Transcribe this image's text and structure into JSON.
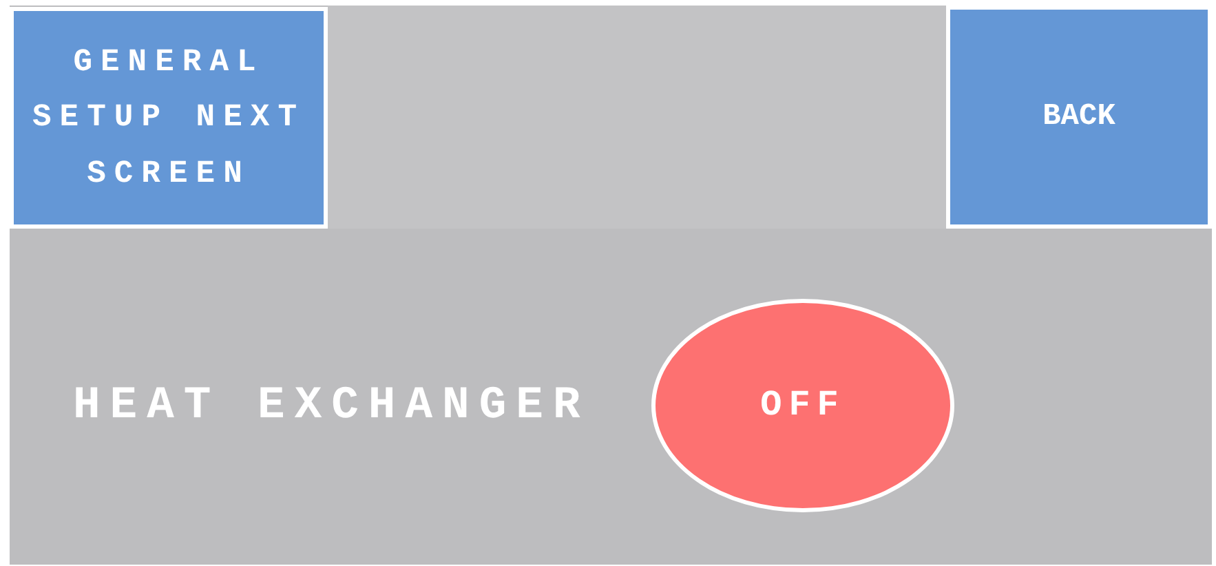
{
  "buttons": [
    {
      "label": "GENERAL SETUP NEXT SCREEN"
    },
    {
      "label": "BACK"
    }
  ],
  "heat_exchanger": {
    "label": "HEAT EXCHANGER",
    "toggle": {
      "label": "OFF",
      "on": false
    }
  }
}
